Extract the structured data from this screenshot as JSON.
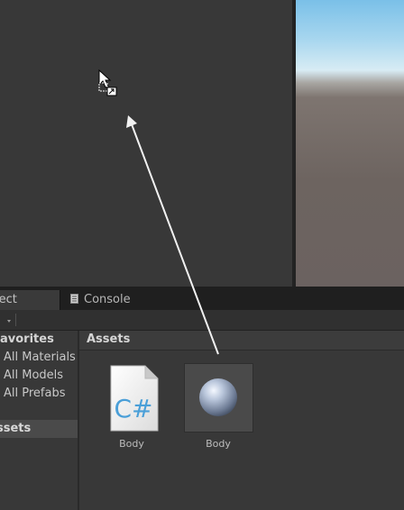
{
  "tabs": {
    "project_label": "ject",
    "console_label": "Console"
  },
  "sidebar": {
    "favorites_title": "avorites",
    "items": [
      {
        "label": "All Materials"
      },
      {
        "label": "All Models"
      },
      {
        "label": "All Prefabs"
      }
    ],
    "assets_label": "ssets"
  },
  "assets_panel": {
    "header": "Assets",
    "items": [
      {
        "label": "Body",
        "type": "csharp-script",
        "icon_text": "C#"
      },
      {
        "label": "Body",
        "type": "material"
      }
    ]
  },
  "icons": {
    "cursor": "drag-cursor-icon",
    "console": "console-icon",
    "dropdown": "chevron-down-icon",
    "arrow": "drag-arrow-icon"
  },
  "colors": {
    "panel_bg": "#383838",
    "tab_bar": "#1f1f1f",
    "selected_row": "#4a4a4a",
    "sky_top": "#7ac0e8",
    "ground": "#6d6460"
  }
}
